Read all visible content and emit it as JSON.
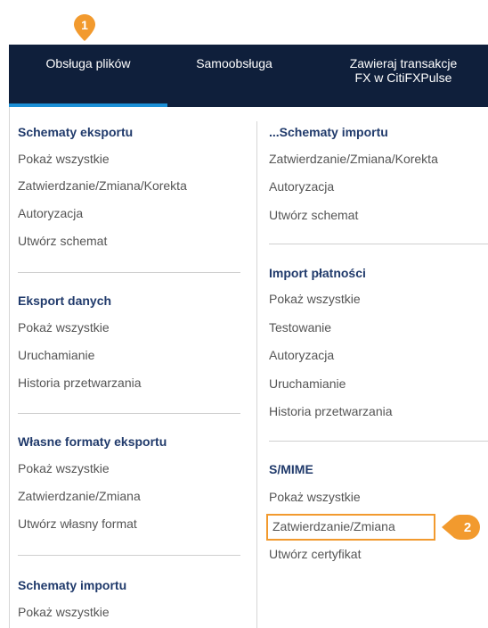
{
  "callouts": {
    "first": "1",
    "second": "2",
    "accent_color": "#f29a2e"
  },
  "topbar": {
    "bg_color": "#0f1f3b",
    "items": [
      {
        "label": "Obsługa plików"
      },
      {
        "label": "Samoobsługa"
      },
      {
        "label_line1": "Zawieraj transakcje",
        "label_line2": "FX w CitiFXPulse"
      }
    ]
  },
  "left_column": {
    "sections": [
      {
        "heading": "Schematy eksportu",
        "items": [
          "Pokaż wszystkie",
          "Zatwierdzanie/Zmiana/Korekta",
          "Autoryzacja",
          "Utwórz schemat"
        ]
      },
      {
        "heading": "Eksport danych",
        "items": [
          "Pokaż wszystkie",
          "Uruchamianie",
          "Historia przetwarzania"
        ]
      },
      {
        "heading": "Własne formaty eksportu",
        "items": [
          "Pokaż wszystkie",
          "Zatwierdzanie/Zmiana",
          "Utwórz własny format"
        ]
      },
      {
        "heading": "Schematy importu",
        "items": [
          "Pokaż wszystkie"
        ]
      }
    ]
  },
  "right_column": {
    "sections": [
      {
        "heading": "...Schematy importu",
        "items": [
          "Zatwierdzanie/Zmiana/Korekta",
          "Autoryzacja",
          "Utwórz schemat"
        ]
      },
      {
        "heading": "Import płatności",
        "items": [
          "Pokaż wszystkie",
          "Testowanie",
          "Autoryzacja",
          "Uruchamianie",
          "Historia przetwarzania"
        ]
      },
      {
        "heading": "S/MIME",
        "items": [
          "Pokaż wszystkie",
          "Zatwierdzanie/Zmiana",
          "Utwórz certyfikat"
        ]
      }
    ]
  }
}
